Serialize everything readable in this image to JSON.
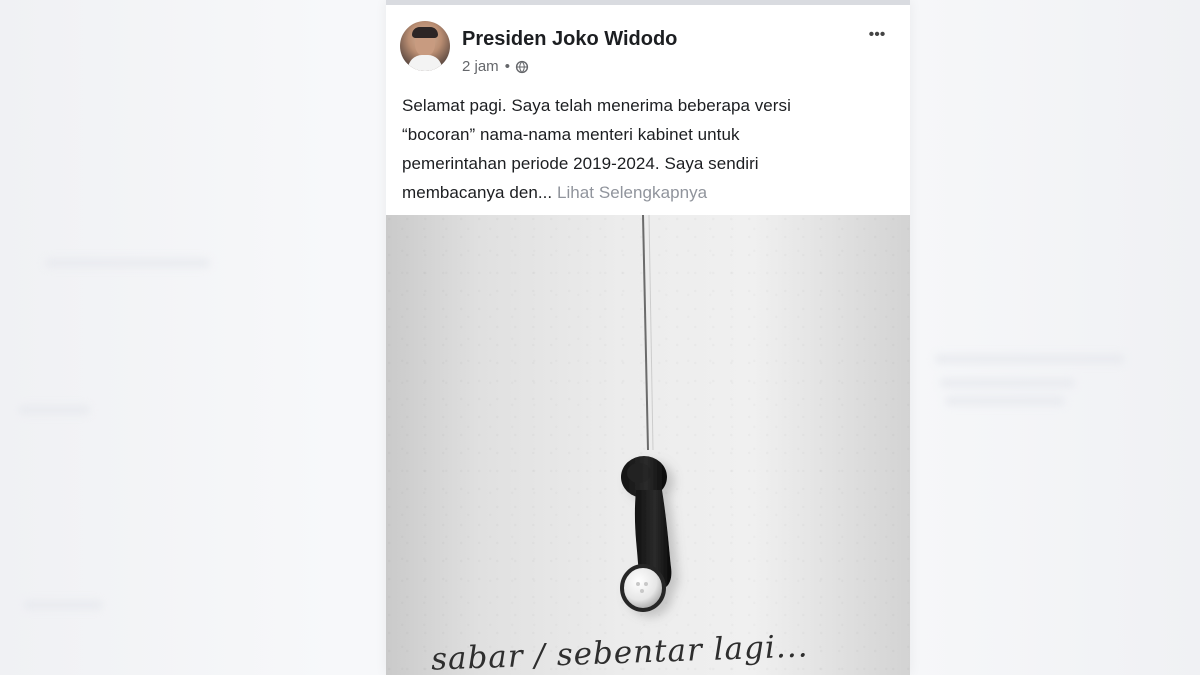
{
  "post": {
    "author_name": "Presiden Joko Widodo",
    "timestamp": "2 jam",
    "separator": "•",
    "privacy_icon": "globe-icon",
    "more_icon": "more-options-icon",
    "more_label": "•••",
    "text_lines": [
      "Selamat pagi. Saya telah menerima beberapa versi",
      "“bocoran” nama-nama menteri kabinet untuk",
      "pemerintahan periode 2019-2024. Saya sendiri",
      "membacanya den..."
    ],
    "see_more": "Lihat Selengkapnya"
  },
  "image": {
    "caption": "sabar / sebentar lagi..."
  },
  "colors": {
    "card_bg": "#ffffff",
    "text": "#1c1e21",
    "muted": "#65676b",
    "see_more": "#90949c",
    "background": "#f4f5f7"
  }
}
